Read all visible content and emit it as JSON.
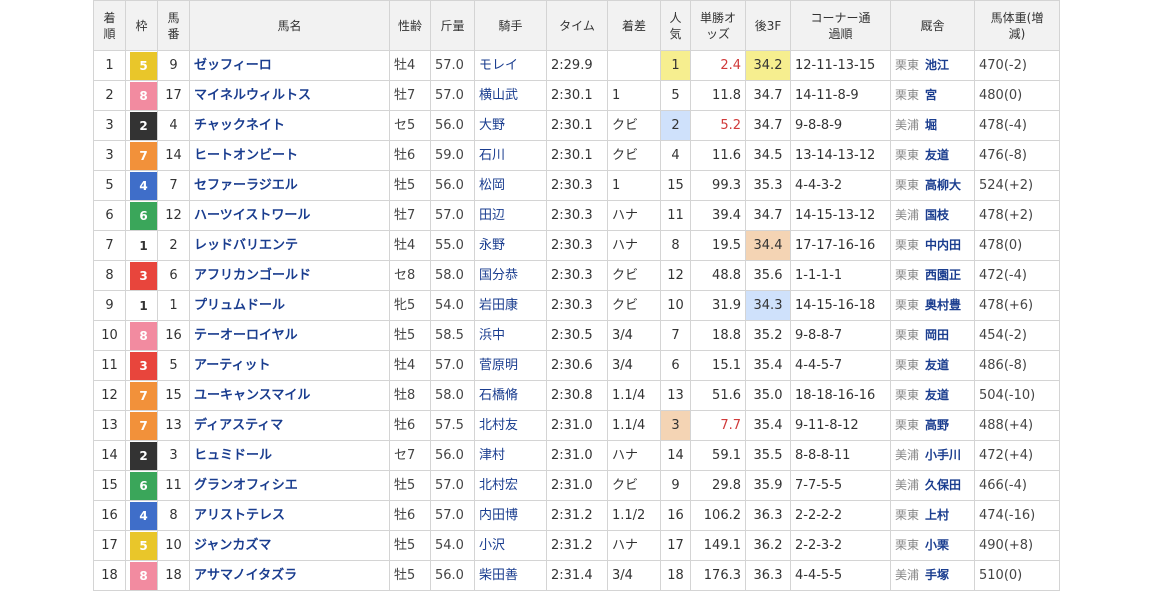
{
  "headers": {
    "rank": "着順",
    "frame": "枠",
    "num": "馬番",
    "name": "馬名",
    "sexage": "性齢",
    "weight": "斤量",
    "jockey": "騎手",
    "time": "タイム",
    "margin": "着差",
    "pop": "人気",
    "odds": "単勝オッズ",
    "last3f": "後3F",
    "corner": "コーナー通過順",
    "stable": "厩舎",
    "bw": "馬体重(増減)"
  },
  "frame_colors": {
    "1": {
      "bg": "#ffffff",
      "fg": "#333333"
    },
    "2": {
      "bg": "#333333",
      "fg": "#ffffff"
    },
    "3": {
      "bg": "#e8453c",
      "fg": "#ffffff"
    },
    "4": {
      "bg": "#3f6ec9",
      "fg": "#ffffff"
    },
    "5": {
      "bg": "#e9c62a",
      "fg": "#ffffff"
    },
    "6": {
      "bg": "#3aa65a",
      "fg": "#ffffff"
    },
    "7": {
      "bg": "#f2913a",
      "fg": "#ffffff"
    },
    "8": {
      "bg": "#f28ba0",
      "fg": "#ffffff"
    }
  },
  "rows": [
    {
      "rank": "1",
      "frame": "5",
      "num": "9",
      "name": "ゼッフィーロ",
      "sexage": "牡4",
      "weight": "57.0",
      "jockey": "モレイ",
      "time": "2:29.9",
      "margin": "",
      "pop": "1",
      "pop_hl": "gold",
      "odds": "2.4",
      "odds_red": true,
      "last3f": "34.2",
      "last3f_hl": "gold",
      "corner": "12-11-13-15",
      "region": "栗東",
      "trainer": "池江",
      "bw": "470(-2)"
    },
    {
      "rank": "2",
      "frame": "8",
      "num": "17",
      "name": "マイネルウィルトス",
      "sexage": "牡7",
      "weight": "57.0",
      "jockey": "横山武",
      "time": "2:30.1",
      "margin": "1",
      "pop": "5",
      "pop_hl": "",
      "odds": "11.8",
      "odds_red": false,
      "last3f": "34.7",
      "last3f_hl": "",
      "corner": "14-11-8-9",
      "region": "栗東",
      "trainer": "宮",
      "bw": "480(0)"
    },
    {
      "rank": "3",
      "frame": "2",
      "num": "4",
      "name": "チャックネイト",
      "sexage": "セ5",
      "weight": "56.0",
      "jockey": "大野",
      "time": "2:30.1",
      "margin": "クビ",
      "pop": "2",
      "pop_hl": "blue",
      "odds": "5.2",
      "odds_red": true,
      "last3f": "34.7",
      "last3f_hl": "",
      "corner": "9-8-8-9",
      "region": "美浦",
      "trainer": "堀",
      "bw": "478(-4)"
    },
    {
      "rank": "3",
      "frame": "7",
      "num": "14",
      "name": "ヒートオンビート",
      "sexage": "牡6",
      "weight": "59.0",
      "jockey": "石川",
      "time": "2:30.1",
      "margin": "クビ",
      "pop": "4",
      "pop_hl": "",
      "odds": "11.6",
      "odds_red": false,
      "last3f": "34.5",
      "last3f_hl": "",
      "corner": "13-14-13-12",
      "region": "栗東",
      "trainer": "友道",
      "bw": "476(-8)"
    },
    {
      "rank": "5",
      "frame": "4",
      "num": "7",
      "name": "セファーラジエル",
      "sexage": "牡5",
      "weight": "56.0",
      "jockey": "松岡",
      "time": "2:30.3",
      "margin": "1",
      "pop": "15",
      "pop_hl": "",
      "odds": "99.3",
      "odds_red": false,
      "last3f": "35.3",
      "last3f_hl": "",
      "corner": "4-4-3-2",
      "region": "栗東",
      "trainer": "高柳大",
      "bw": "524(+2)"
    },
    {
      "rank": "6",
      "frame": "6",
      "num": "12",
      "name": "ハーツイストワール",
      "sexage": "牡7",
      "weight": "57.0",
      "jockey": "田辺",
      "time": "2:30.3",
      "margin": "ハナ",
      "pop": "11",
      "pop_hl": "",
      "odds": "39.4",
      "odds_red": false,
      "last3f": "34.7",
      "last3f_hl": "",
      "corner": "14-15-13-12",
      "region": "美浦",
      "trainer": "国枝",
      "bw": "478(+2)"
    },
    {
      "rank": "7",
      "frame": "1",
      "num": "2",
      "name": "レッドバリエンテ",
      "sexage": "牡4",
      "weight": "55.0",
      "jockey": "永野",
      "time": "2:30.3",
      "margin": "ハナ",
      "pop": "8",
      "pop_hl": "",
      "odds": "19.5",
      "odds_red": false,
      "last3f": "34.4",
      "last3f_hl": "orange",
      "corner": "17-17-16-16",
      "region": "栗東",
      "trainer": "中内田",
      "bw": "478(0)"
    },
    {
      "rank": "8",
      "frame": "3",
      "num": "6",
      "name": "アフリカンゴールド",
      "sexage": "セ8",
      "weight": "58.0",
      "jockey": "国分恭",
      "time": "2:30.3",
      "margin": "クビ",
      "pop": "12",
      "pop_hl": "",
      "odds": "48.8",
      "odds_red": false,
      "last3f": "35.6",
      "last3f_hl": "",
      "corner": "1-1-1-1",
      "region": "栗東",
      "trainer": "西園正",
      "bw": "472(-4)"
    },
    {
      "rank": "9",
      "frame": "1",
      "num": "1",
      "name": "プリュムドール",
      "sexage": "牝5",
      "weight": "54.0",
      "jockey": "岩田康",
      "time": "2:30.3",
      "margin": "クビ",
      "pop": "10",
      "pop_hl": "",
      "odds": "31.9",
      "odds_red": false,
      "last3f": "34.3",
      "last3f_hl": "blue",
      "corner": "14-15-16-18",
      "region": "栗東",
      "trainer": "奥村豊",
      "bw": "478(+6)"
    },
    {
      "rank": "10",
      "frame": "8",
      "num": "16",
      "name": "テーオーロイヤル",
      "sexage": "牡5",
      "weight": "58.5",
      "jockey": "浜中",
      "time": "2:30.5",
      "margin": "3/4",
      "pop": "7",
      "pop_hl": "",
      "odds": "18.8",
      "odds_red": false,
      "last3f": "35.2",
      "last3f_hl": "",
      "corner": "9-8-8-7",
      "region": "栗東",
      "trainer": "岡田",
      "bw": "454(-2)"
    },
    {
      "rank": "11",
      "frame": "3",
      "num": "5",
      "name": "アーティット",
      "sexage": "牡4",
      "weight": "57.0",
      "jockey": "菅原明",
      "time": "2:30.6",
      "margin": "3/4",
      "pop": "6",
      "pop_hl": "",
      "odds": "15.1",
      "odds_red": false,
      "last3f": "35.4",
      "last3f_hl": "",
      "corner": "4-4-5-7",
      "region": "栗東",
      "trainer": "友道",
      "bw": "486(-8)"
    },
    {
      "rank": "12",
      "frame": "7",
      "num": "15",
      "name": "ユーキャンスマイル",
      "sexage": "牡8",
      "weight": "58.0",
      "jockey": "石橋脩",
      "time": "2:30.8",
      "margin": "1.1/4",
      "pop": "13",
      "pop_hl": "",
      "odds": "51.6",
      "odds_red": false,
      "last3f": "35.0",
      "last3f_hl": "",
      "corner": "18-18-16-16",
      "region": "栗東",
      "trainer": "友道",
      "bw": "504(-10)"
    },
    {
      "rank": "13",
      "frame": "7",
      "num": "13",
      "name": "ディアスティマ",
      "sexage": "牡6",
      "weight": "57.5",
      "jockey": "北村友",
      "time": "2:31.0",
      "margin": "1.1/4",
      "pop": "3",
      "pop_hl": "orange",
      "odds": "7.7",
      "odds_red": true,
      "last3f": "35.4",
      "last3f_hl": "",
      "corner": "9-11-8-12",
      "region": "栗東",
      "trainer": "高野",
      "bw": "488(+4)"
    },
    {
      "rank": "14",
      "frame": "2",
      "num": "3",
      "name": "ヒュミドール",
      "sexage": "セ7",
      "weight": "56.0",
      "jockey": "津村",
      "time": "2:31.0",
      "margin": "ハナ",
      "pop": "14",
      "pop_hl": "",
      "odds": "59.1",
      "odds_red": false,
      "last3f": "35.5",
      "last3f_hl": "",
      "corner": "8-8-8-11",
      "region": "美浦",
      "trainer": "小手川",
      "bw": "472(+4)"
    },
    {
      "rank": "15",
      "frame": "6",
      "num": "11",
      "name": "グランオフィシエ",
      "sexage": "牡5",
      "weight": "57.0",
      "jockey": "北村宏",
      "time": "2:31.0",
      "margin": "クビ",
      "pop": "9",
      "pop_hl": "",
      "odds": "29.8",
      "odds_red": false,
      "last3f": "35.9",
      "last3f_hl": "",
      "corner": "7-7-5-5",
      "region": "美浦",
      "trainer": "久保田",
      "bw": "466(-4)"
    },
    {
      "rank": "16",
      "frame": "4",
      "num": "8",
      "name": "アリストテレス",
      "sexage": "牡6",
      "weight": "57.0",
      "jockey": "内田博",
      "time": "2:31.2",
      "margin": "1.1/2",
      "pop": "16",
      "pop_hl": "",
      "odds": "106.2",
      "odds_red": false,
      "last3f": "36.3",
      "last3f_hl": "",
      "corner": "2-2-2-2",
      "region": "栗東",
      "trainer": "上村",
      "bw": "474(-16)"
    },
    {
      "rank": "17",
      "frame": "5",
      "num": "10",
      "name": "ジャンカズマ",
      "sexage": "牡5",
      "weight": "54.0",
      "jockey": "小沢",
      "time": "2:31.2",
      "margin": "ハナ",
      "pop": "17",
      "pop_hl": "",
      "odds": "149.1",
      "odds_red": false,
      "last3f": "36.2",
      "last3f_hl": "",
      "corner": "2-2-3-2",
      "region": "栗東",
      "trainer": "小栗",
      "bw": "490(+8)"
    },
    {
      "rank": "18",
      "frame": "8",
      "num": "18",
      "name": "アサマノイタズラ",
      "sexage": "牡5",
      "weight": "56.0",
      "jockey": "柴田善",
      "time": "2:31.4",
      "margin": "3/4",
      "pop": "18",
      "pop_hl": "",
      "odds": "176.3",
      "odds_red": false,
      "last3f": "36.3",
      "last3f_hl": "",
      "corner": "4-4-5-5",
      "region": "美浦",
      "trainer": "手塚",
      "bw": "510(0)"
    }
  ]
}
